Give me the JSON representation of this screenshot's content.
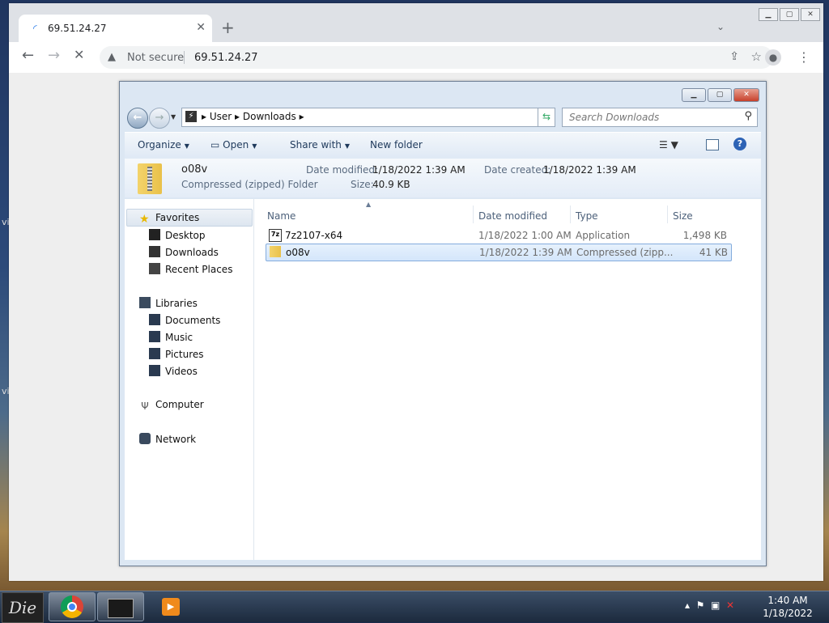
{
  "browser": {
    "tab_title": "69.51.24.27",
    "security_label": "Not secure",
    "url": "69.51.24.27"
  },
  "explorer": {
    "breadcrumb": [
      "User",
      "Downloads"
    ],
    "search_placeholder": "Search Downloads",
    "commands": {
      "organize": "Organize",
      "open": "Open",
      "share_with": "Share with",
      "new_folder": "New folder"
    },
    "details": {
      "name": "o08v",
      "type": "Compressed (zipped) Folder",
      "date_modified_label": "Date modified:",
      "date_modified": "1/18/2022 1:39 AM",
      "date_created_label": "Date created:",
      "date_created": "1/18/2022 1:39 AM",
      "size_label": "Size:",
      "size": "40.9 KB"
    },
    "nav": {
      "favorites": "Favorites",
      "desktop": "Desktop",
      "downloads": "Downloads",
      "recent_places": "Recent Places",
      "libraries": "Libraries",
      "documents": "Documents",
      "music": "Music",
      "pictures": "Pictures",
      "videos": "Videos",
      "computer": "Computer",
      "network": "Network"
    },
    "columns": {
      "name": "Name",
      "date_modified": "Date modified",
      "type": "Type",
      "size": "Size"
    },
    "files": [
      {
        "name": "7z2107-x64",
        "date": "1/18/2022 1:00 AM",
        "type": "Application",
        "size": "1,498 KB",
        "icon": "7zip-exe-icon"
      },
      {
        "name": "o08v",
        "date": "1/18/2022 1:39 AM",
        "type": "Compressed (zipp...",
        "size": "41 KB",
        "icon": "zip-folder-icon"
      }
    ]
  },
  "taskbar": {
    "start_label": "Die",
    "time": "1:40 AM",
    "date": "1/18/2022"
  },
  "desktop_fragments": [
    "vi",
    "vi"
  ]
}
